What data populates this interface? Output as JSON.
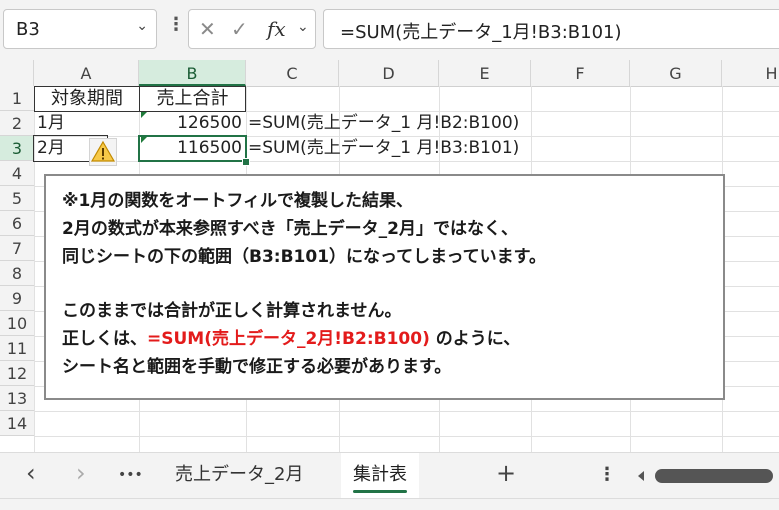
{
  "formula_bar": {
    "name_box": "B3",
    "name_box_chevron": "⌄",
    "more_icon": "⋮",
    "cancel_icon": "✕",
    "enter_icon": "✓",
    "fx_label": "fx",
    "fx_chevron": "⌄",
    "formula": "=SUM(売上データ_1月!B3:B101)"
  },
  "columns": [
    "A",
    "B",
    "C",
    "D",
    "E",
    "F",
    "G",
    "H"
  ],
  "selected_column": "B",
  "rows": [
    "1",
    "2",
    "3",
    "4",
    "5",
    "6",
    "7",
    "8",
    "9",
    "10",
    "11",
    "12",
    "13",
    "14"
  ],
  "selected_row": "3",
  "cells": {
    "A1": "対象期間",
    "B1": "売上合計",
    "A2": "1月",
    "B2": "126500",
    "C2": "=SUM(売上データ_1 月!B2:B100)",
    "A3": "2月",
    "B3": "116500",
    "C3": "=SUM(売上データ_1 月!B3:B101)"
  },
  "warning_icon": "⚠",
  "note": {
    "line1": "※1月の関数をオートフィルで複製した結果、",
    "line2": "2月の数式が本来参照すべき「売上データ_2月」ではなく、",
    "line3": "同じシートの下の範囲（B3:B101）になってしまっています。",
    "line4": "このままでは合計が正しく計算されません。",
    "line5_prefix": "正しくは、",
    "line5_formula": "=SUM(売上データ_2月!B2:B100)",
    "line5_suffix": " のように、",
    "line6": "シート名と範囲を手動で修正する必要があります。",
    "accent_color": "#e31b1b"
  },
  "sheet_tabs": {
    "prev_icon": "‹",
    "next_icon": "›",
    "more_icon": "•••",
    "tabs": [
      "売上データ_2月",
      "集計表"
    ],
    "active_tab": "集計表",
    "add_icon": "+",
    "options_icon": "⋮"
  },
  "accent": "#217346"
}
